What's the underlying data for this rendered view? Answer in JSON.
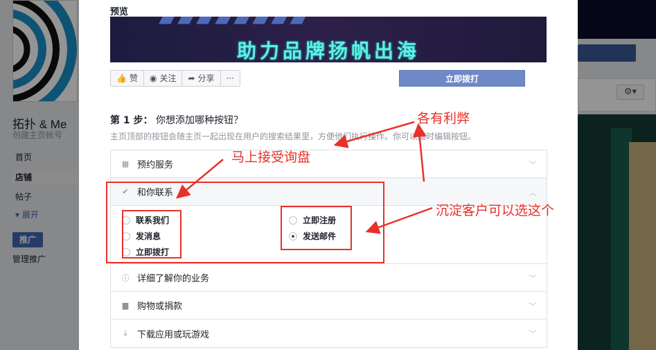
{
  "background": {
    "page_name": "拓扑 & Me",
    "page_handle": "创建主页帐号",
    "nav": [
      "首页",
      "店铺",
      "帖子"
    ],
    "expand": "展开",
    "promote": "推广",
    "manage_promotions": "管理推广",
    "settings_icon": "gear-icon"
  },
  "modal": {
    "preview_label": "预览",
    "banner_text": "助力品牌扬帆出海",
    "actions": {
      "like": "赞",
      "follow": "关注",
      "share": "分享",
      "more": "···"
    },
    "call_button": "立即拨打",
    "step": {
      "label": "第 1 步：",
      "question": "你想添加哪种按钮？",
      "description": "主页顶部的按钮会随主页一起出现在用户的搜索结果里，方便他们执行操作。你可以随时编辑按钮。"
    },
    "categories": {
      "book": "预约服务",
      "contact": "和你联系",
      "learn": "详细了解你的业务",
      "shop": "购物或捐款",
      "download": "下载应用或玩游戏"
    },
    "contact_options": {
      "contact_us": "联系我们",
      "send_message": "发消息",
      "call_now": "立即拨打",
      "sign_up": "立即注册",
      "send_email": "发送邮件"
    },
    "selected_option": "发送邮件"
  },
  "annotations": {
    "pros_cons": "各有利弊",
    "inquiries": "马上接受询盘",
    "retain": "沉淀客户可以选这个",
    "color": "#e8312a"
  }
}
